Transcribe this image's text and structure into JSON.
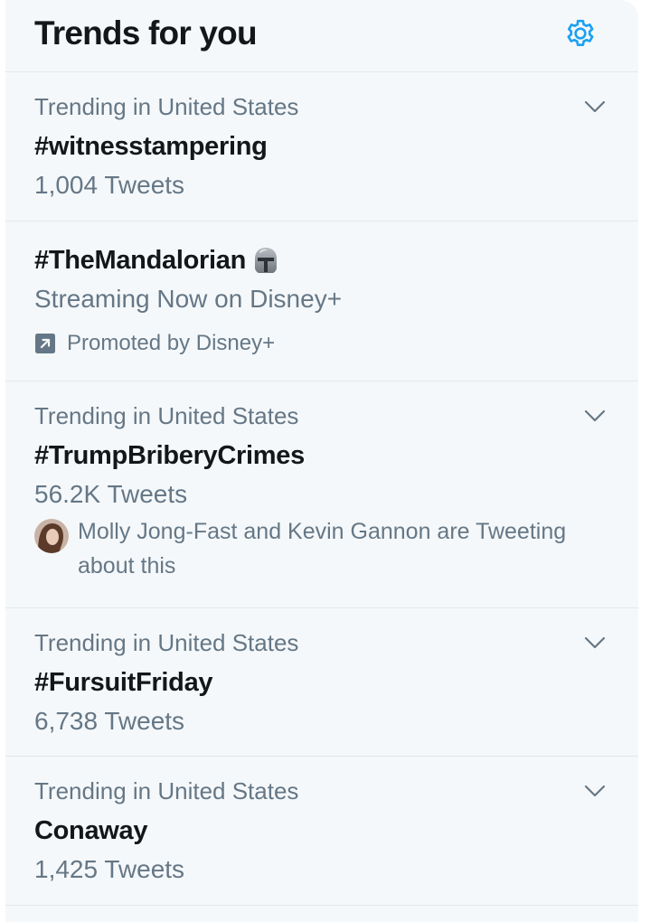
{
  "header": {
    "title": "Trends for you",
    "settings_icon": "gear-icon",
    "accent_color": "#1da1f2"
  },
  "trends": [
    {
      "context": "Trending in United States",
      "name": "#witnesstampering",
      "count": "1,004 Tweets",
      "menu_icon": "chevron-down-icon"
    },
    {
      "name": "#TheMandalorian",
      "description": "Streaming Now on Disney+",
      "promoted": "Promoted by Disney+",
      "hashflag_icon": "mandalorian-helmet-icon",
      "promoted_icon": "promoted-arrow-icon"
    },
    {
      "context": "Trending in United States",
      "name": "#TrumpBriberyCrimes",
      "count": "56.2K Tweets",
      "social_context": "Molly Jong-Fast and Kevin Gannon are Tweeting about this",
      "menu_icon": "chevron-down-icon"
    },
    {
      "context": "Trending in United States",
      "name": "#FursuitFriday",
      "count": "6,738 Tweets",
      "menu_icon": "chevron-down-icon"
    },
    {
      "context": "Trending in United States",
      "name": "Conaway",
      "count": "1,425 Tweets",
      "menu_icon": "chevron-down-icon"
    }
  ]
}
